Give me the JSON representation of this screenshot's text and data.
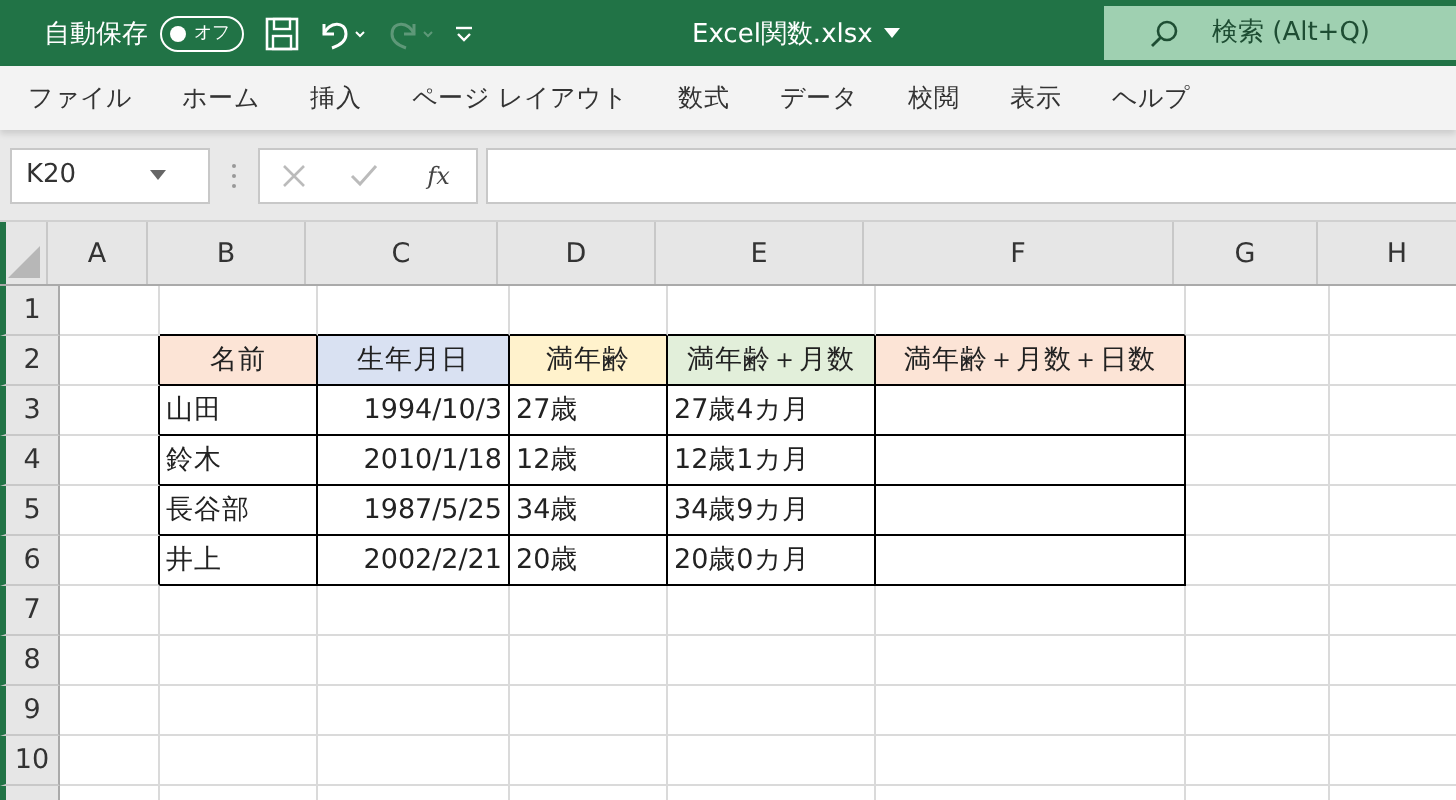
{
  "title_bar": {
    "autosave_label": "自動保存",
    "autosave_toggle": {
      "label": "オフ",
      "on": false
    },
    "undo_disabled": false,
    "redo_disabled": true,
    "file_name": "Excel関数.xlsx",
    "search": {
      "placeholder": "検索 (Alt+Q)"
    }
  },
  "menu_tabs": [
    "ファイル",
    "ホーム",
    "挿入",
    "ページ レイアウト",
    "数式",
    "データ",
    "校閲",
    "表示",
    "ヘルプ"
  ],
  "formula_bar": {
    "name_box": "K20",
    "function_label": "fx"
  },
  "sheet": {
    "columns": [
      "A",
      "B",
      "C",
      "D",
      "E",
      "F",
      "G",
      "H"
    ],
    "rows": [
      "1",
      "2",
      "3",
      "4",
      "5",
      "6",
      "7",
      "8",
      "9",
      "10"
    ],
    "table": {
      "headers": [
        {
          "text": "名前",
          "color": "#fce4d6"
        },
        {
          "text": "生年月日",
          "color": "#d9e1f2"
        },
        {
          "text": "満年齢",
          "color": "#fff2cc"
        },
        {
          "text": "満年齢＋月数",
          "color": "#e2efda"
        },
        {
          "text": "満年齢＋月数＋日数",
          "color": "#fce4d6"
        }
      ],
      "rows": [
        {
          "name": "山田",
          "birth": "1994/10/3",
          "age": "27歳",
          "age_months": "27歳4カ月"
        },
        {
          "name": "鈴木",
          "birth": "2010/1/18",
          "age": "12歳",
          "age_months": "12歳1カ月"
        },
        {
          "name": "長谷部",
          "birth": "1987/5/25",
          "age": "34歳",
          "age_months": "34歳9カ月"
        },
        {
          "name": "井上",
          "birth": "2002/2/21",
          "age": "20歳",
          "age_months": "20歳0カ月"
        }
      ]
    }
  }
}
